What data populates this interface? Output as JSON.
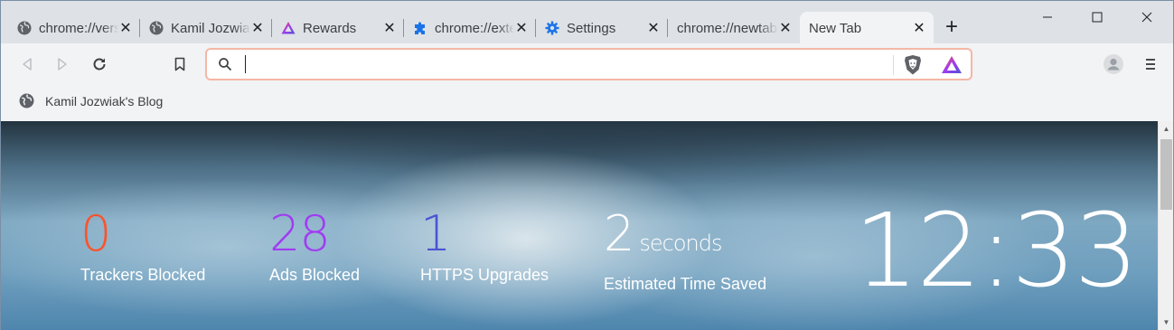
{
  "tabs": [
    {
      "title": "chrome://version",
      "icon": "globe-icon",
      "active": false
    },
    {
      "title": "Kamil Jozwiak",
      "icon": "globe-icon",
      "active": false
    },
    {
      "title": "Rewards",
      "icon": "brave-rewards-icon",
      "active": false
    },
    {
      "title": "chrome://extensions",
      "icon": "puzzle-icon",
      "active": false
    },
    {
      "title": "Settings",
      "icon": "gear-icon",
      "active": false
    },
    {
      "title": "chrome://newtab",
      "icon": "none",
      "active": false
    },
    {
      "title": "New Tab",
      "icon": "none",
      "active": true
    }
  ],
  "tab_close_glyph": "✕",
  "new_tab_glyph": "+",
  "window": {
    "minimize": "—",
    "maximize": "☐",
    "close": "✕"
  },
  "omnibox": {
    "value": "",
    "placeholder": ""
  },
  "bookmarks": [
    {
      "label": "Kamil Jozwiak's Blog",
      "icon": "globe-icon"
    }
  ],
  "stats": {
    "trackers": {
      "value": "0",
      "label": "Trackers Blocked",
      "color": "#fb542b"
    },
    "ads": {
      "value": "28",
      "label": "Ads Blocked",
      "color": "#a13bf2"
    },
    "https": {
      "value": "1",
      "label": "HTTPS Upgrades",
      "color": "#4c54d2"
    },
    "time": {
      "value": "2",
      "unit": "seconds",
      "label": "Estimated Time Saved",
      "color": "#ffffff"
    }
  },
  "clock": "12:33",
  "colors": {
    "omnibox_border": "#f5b7a6",
    "tabstrip": "#dee1e6",
    "toolbar": "#f1f3f4"
  }
}
